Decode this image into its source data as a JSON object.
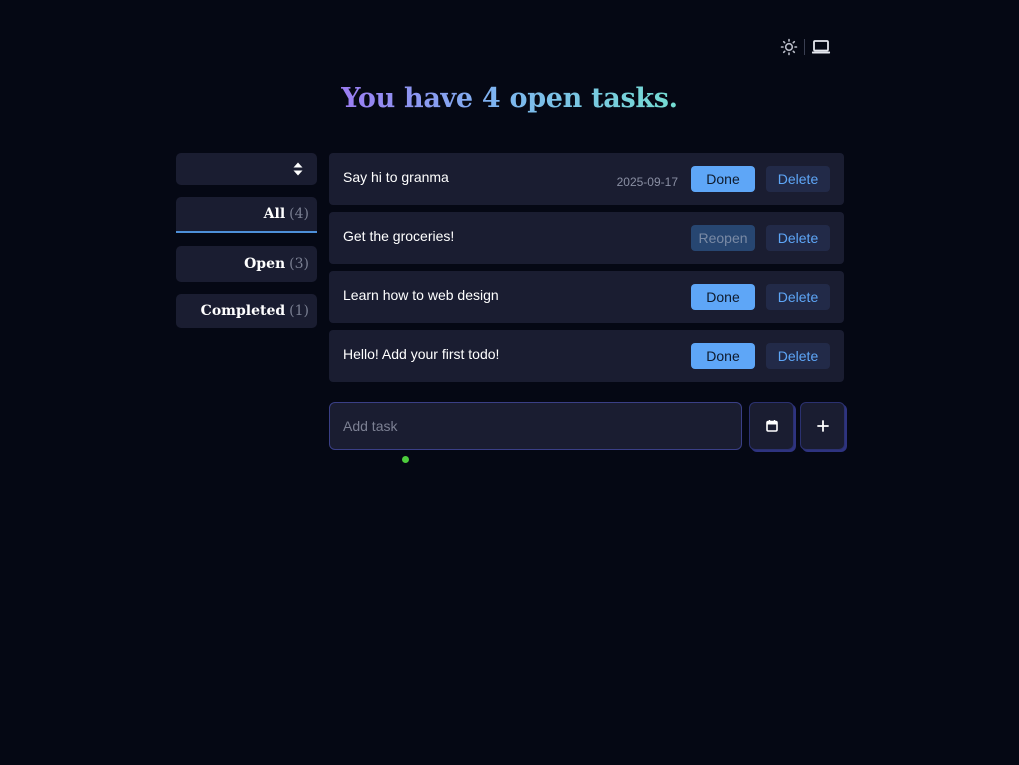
{
  "theme": {
    "light_icon": "sun-icon",
    "system_icon": "laptop-icon"
  },
  "heading": {
    "text": "You have 4 open tasks."
  },
  "sidebar": {
    "sort_icon": "sort-updown-icon",
    "filters": [
      {
        "label": "All",
        "count": "(4)",
        "active": true
      },
      {
        "label": "Open",
        "count": "(3)",
        "active": false
      },
      {
        "label": "Completed",
        "count": "(1)",
        "active": false
      }
    ]
  },
  "tasks": [
    {
      "title": "Say hi to granma",
      "date": "2025-09-17",
      "action": "Done",
      "delete": "Delete"
    },
    {
      "title": "Get the groceries!",
      "date": "",
      "action": "Reopen",
      "delete": "Delete"
    },
    {
      "title": "Learn how to web design",
      "date": "",
      "action": "Done",
      "delete": "Delete"
    },
    {
      "title": "Hello! Add your first todo!",
      "date": "",
      "action": "Done",
      "delete": "Delete"
    }
  ],
  "add_task": {
    "placeholder": "Add task",
    "value": "",
    "calendar_icon": "calendar-icon",
    "add_icon": "plus-icon"
  },
  "colors": {
    "background": "#050814",
    "card": "#1a1d31",
    "accent": "#5ea6f7",
    "status_dot": "#4dcc3c"
  }
}
